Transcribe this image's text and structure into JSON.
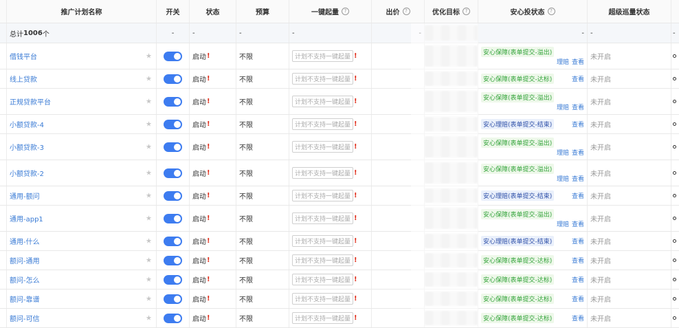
{
  "headers": {
    "name": "推广计划名称",
    "switch": "开关",
    "status": "状态",
    "budget": "预算",
    "oneclick": "一键起量",
    "bid": "出价",
    "target": "优化目标",
    "anxin": "安心投状态",
    "patrol": "超级巡量状态"
  },
  "summary": {
    "label": "总计 ",
    "count": "1006",
    "unit": "个",
    "dash": "-"
  },
  "texts": {
    "status": "启动",
    "warn": "!",
    "budget": "不限",
    "oneclick_placeholder": "计划不支持一键起量",
    "action_claim": "理赔",
    "action_view": "查看",
    "patrol_off": "未开启"
  },
  "rows": [
    {
      "name": "借钱平台",
      "anxin": "安心保障(表单提交-溢出)",
      "tone": "green",
      "claim": true,
      "h": 38
    },
    {
      "name": "线上贷款",
      "anxin": "安心保障(表单提交-达标)",
      "tone": "green",
      "claim": false,
      "h": 28
    },
    {
      "name": "正规贷款平台",
      "anxin": "安心保障(表单提交-溢出)",
      "tone": "green",
      "claim": true,
      "h": 38
    },
    {
      "name": "小额贷款-4",
      "anxin": "安心理赔(表单提交-结束)",
      "tone": "blue",
      "claim": false,
      "h": 28
    },
    {
      "name": "小额贷款-3",
      "anxin": "安心保障(表单提交-溢出)",
      "tone": "green",
      "claim": true,
      "h": 38
    },
    {
      "name": "小额贷款-2",
      "anxin": "安心保障(表单提交-溢出)",
      "tone": "green",
      "claim": true,
      "h": 38
    },
    {
      "name": "通用-额问",
      "anxin": "安心理赔(表单提交-结束)",
      "tone": "blue",
      "claim": false,
      "h": 28
    },
    {
      "name": "通用-app1",
      "anxin": "安心保障(表单提交-溢出)",
      "tone": "green",
      "claim": true,
      "h": 38
    },
    {
      "name": "通用-什么",
      "anxin": "安心理赔(表单提交-结束)",
      "tone": "blue",
      "claim": false,
      "h": 28
    },
    {
      "name": "额问-通用",
      "anxin": "安心保障(表单提交-达标)",
      "tone": "green",
      "claim": false,
      "h": 28
    },
    {
      "name": "额问-怎么",
      "anxin": "安心保障(表单提交-达标)",
      "tone": "green",
      "claim": false,
      "h": 28
    },
    {
      "name": "额问-靠谱",
      "anxin": "安心保障(表单提交-达标)",
      "tone": "green",
      "claim": false,
      "h": 28
    },
    {
      "name": "额问-可信",
      "anxin": "安心保障(表单提交-达标)",
      "tone": "green",
      "claim": false,
      "h": 28
    }
  ]
}
